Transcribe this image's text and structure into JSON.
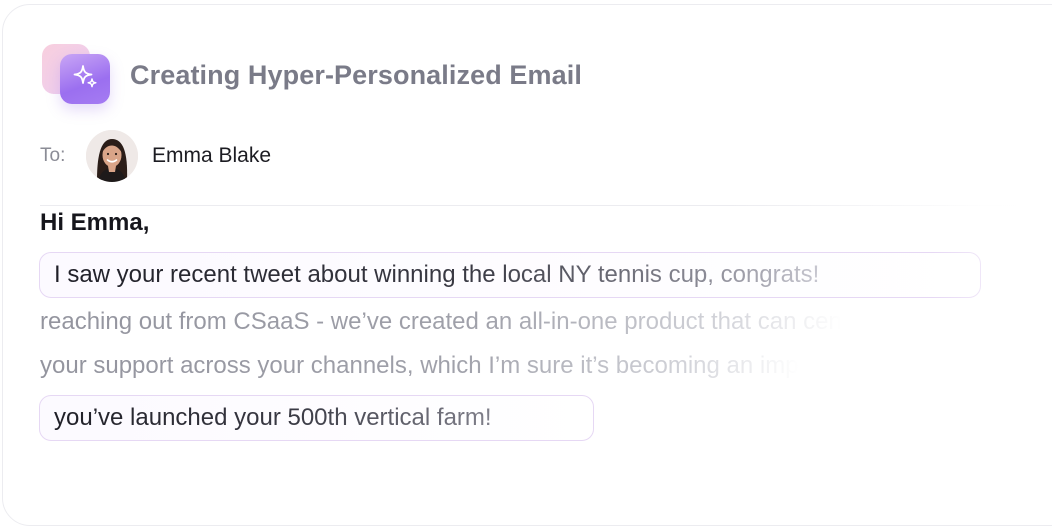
{
  "header": {
    "title": "Creating Hyper-Personalized Email",
    "icon": "sparkles-icon",
    "icon_colors": {
      "back": "#f7c6d8",
      "front": "#9b6ff0"
    }
  },
  "recipient": {
    "label": "To:",
    "name": "Emma Blake"
  },
  "email": {
    "greeting": "Hi Emma,",
    "highlight_1": "I saw your recent tweet about winning the local NY tennis cup, congrats!",
    "line_2": "reaching out from CSaaS - we’ve created an all-in-one product that can cen",
    "line_3": "your support across your channels, which I’m sure it’s becoming an imp",
    "highlight_2": "you’ve launched your 500th vertical farm!"
  },
  "colors": {
    "accent": "#9b6ff0",
    "highlight_border": "#e6d8f4",
    "title_text": "#7a7b88"
  }
}
